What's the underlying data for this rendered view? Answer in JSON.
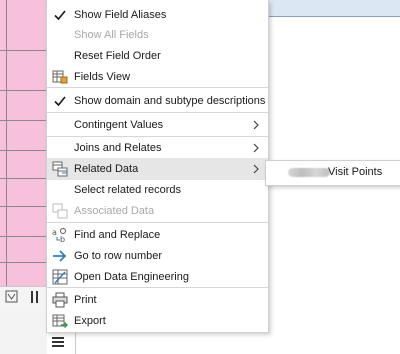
{
  "menu": {
    "items": [
      {
        "label": "Show Field Aliases",
        "icon": "checkmark-icon",
        "disabled": false
      },
      {
        "label": "Show All Fields",
        "icon": "",
        "disabled": true
      },
      {
        "label": "Reset Field Order",
        "icon": "",
        "disabled": false
      },
      {
        "label": "Fields View",
        "icon": "fields-view-icon",
        "disabled": false
      },
      {
        "label": "Show domain and subtype descriptions",
        "icon": "checkmark-icon",
        "disabled": false
      },
      {
        "label": "Contingent Values",
        "icon": "",
        "disabled": false,
        "submenu": true
      },
      {
        "label": "Joins and Relates",
        "icon": "",
        "disabled": false,
        "submenu": true
      },
      {
        "label": "Related Data",
        "icon": "related-data-icon",
        "disabled": false,
        "submenu": true,
        "highlighted": true
      },
      {
        "label": "Select related records",
        "icon": "",
        "disabled": false
      },
      {
        "label": "Associated Data",
        "icon": "associated-data-icon",
        "disabled": true
      },
      {
        "label": "Find and Replace",
        "icon": "find-replace-icon",
        "disabled": false
      },
      {
        "label": "Go to row number",
        "icon": "arrow-right-icon",
        "disabled": false
      },
      {
        "label": "Open Data Engineering",
        "icon": "data-engineering-icon",
        "disabled": false
      },
      {
        "label": "Print",
        "icon": "printer-icon",
        "disabled": false
      },
      {
        "label": "Export",
        "icon": "export-icon",
        "disabled": false
      }
    ]
  },
  "submenu": {
    "item_label": "Visit Points"
  },
  "colors": {
    "pink": "#f7c1dc",
    "highlight": "#e6e6e6",
    "accent_blue": "#2f7fc1"
  }
}
